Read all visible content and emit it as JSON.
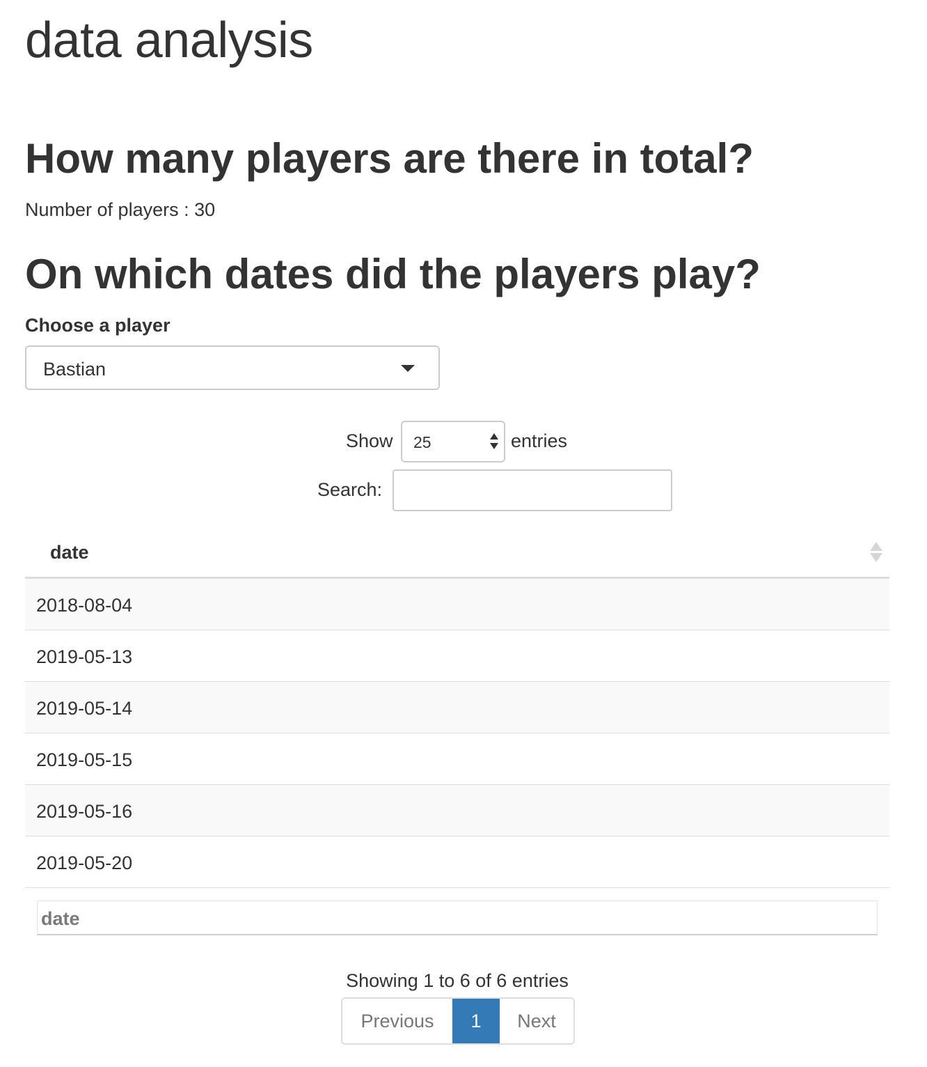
{
  "app": {
    "title": "data analysis"
  },
  "section_players": {
    "heading": "How many players are there in total?",
    "stat_text": "Number of players : 30"
  },
  "section_dates": {
    "heading": "On which dates did the players play?",
    "select_label": "Choose a player",
    "selected_player": "Bastian"
  },
  "table_controls": {
    "show_label": "Show",
    "page_length": "25",
    "entries_label": "entries",
    "search_label": "Search:",
    "search_value": ""
  },
  "table": {
    "column_header": "date",
    "footer_filter_label": "date",
    "rows": [
      "2018-08-04",
      "2019-05-13",
      "2019-05-14",
      "2019-05-15",
      "2019-05-16",
      "2019-05-20"
    ]
  },
  "pagination": {
    "info": "Showing 1 to 6 of 6 entries",
    "previous_label": "Previous",
    "current_page": "1",
    "next_label": "Next"
  },
  "colors": {
    "accent": "#337ab7",
    "text": "#333333",
    "striped_row": "#f9f9f9",
    "border": "#dddddd"
  },
  "icons": {
    "select_caret": "caret-down-icon",
    "length_spinner": "spinner-arrows-icon",
    "column_sort": "sort-both-icon"
  }
}
